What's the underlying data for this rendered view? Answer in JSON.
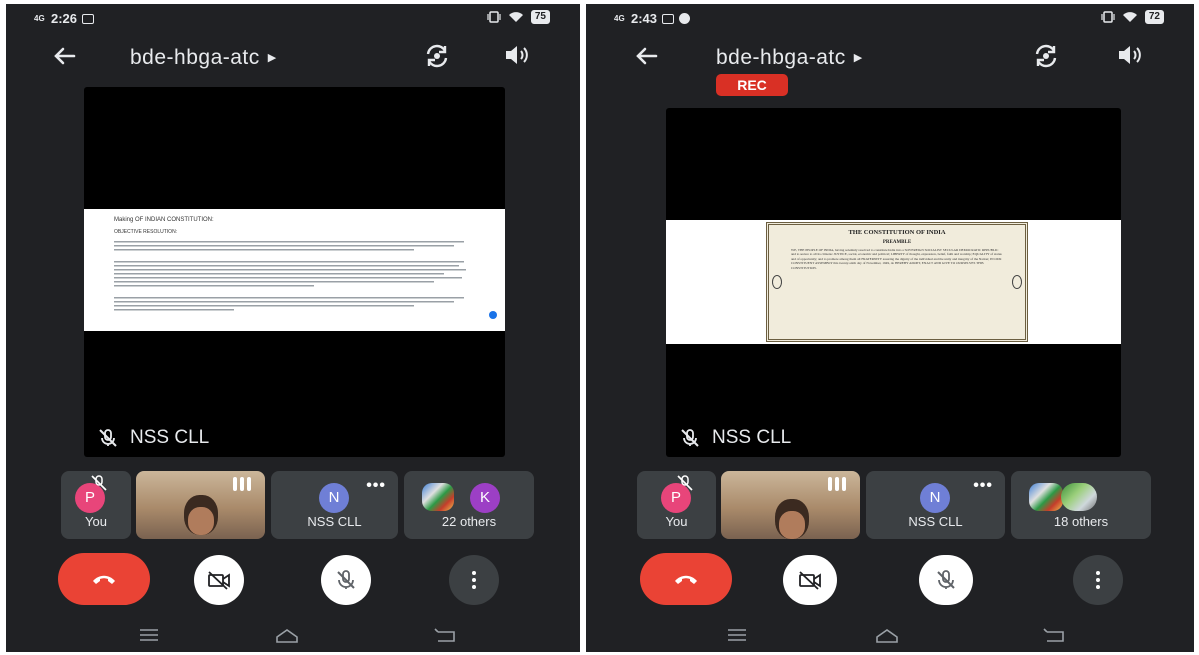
{
  "left": {
    "status": {
      "time": "2:26",
      "network": "4G",
      "battery": "75"
    },
    "meeting_title": "bde-hbga-atc",
    "presenter_name": "NSS CLL",
    "participants": [
      {
        "avatar_letter": "P",
        "label": "You",
        "avatar_color": "#e8457a"
      },
      {
        "label": ""
      },
      {
        "avatar_letter": "N",
        "label": "NSS CLL",
        "avatar_color": "#6f7fd6"
      },
      {
        "avatar_letter": "K",
        "label": "22 others",
        "avatar_color": "#9c3fc5"
      }
    ],
    "document": {
      "heading": "Making OF INDIAN CONSTITUTION:",
      "subheading": "OBJECTIVE RESOLUTION:"
    }
  },
  "right": {
    "status": {
      "time": "2:43",
      "network": "4G",
      "battery": "72"
    },
    "meeting_title": "bde-hbga-atc",
    "recording_label": "REC",
    "presenter_name": "NSS CLL",
    "participants": [
      {
        "avatar_letter": "P",
        "label": "You",
        "avatar_color": "#e8457a"
      },
      {
        "label": ""
      },
      {
        "avatar_letter": "N",
        "label": "NSS CLL",
        "avatar_color": "#6f7fd6"
      },
      {
        "label": "18 others"
      }
    ],
    "document": {
      "heading": "THE CONSTITUTION OF INDIA",
      "subheading": "PREAMBLE",
      "body": "WE, THE PEOPLE OF INDIA, having solemnly resolved to constitute India into a SOVEREIGN SOCIALIST SECULAR DEMOCRATIC REPUBLIC and to secure to all its citizens: JUSTICE, social, economic and political; LIBERTY of thought, expression, belief, faith and worship; EQUALITY of status and of opportunity; and to promote among them all FRATERNITY assuring the dignity of the individual and the unity and integrity of the Nation; IN OUR CONSTITUENT ASSEMBLY this twenty-sixth day of November, 1949, do HEREBY ADOPT, ENACT AND GIVE TO OURSELVES THIS CONSTITUTION."
    }
  },
  "colors": {
    "background": "#202124",
    "tile": "#3c4043",
    "end_call": "#ea4335",
    "rec": "#d93025"
  },
  "icons": [
    "back-arrow-icon",
    "caret-right-icon",
    "switch-camera-icon",
    "speaker-icon",
    "mic-off-icon",
    "more-vert-icon",
    "end-call-icon",
    "camera-off-icon",
    "recents-icon",
    "home-icon",
    "back-nav-icon",
    "bars-icon"
  ]
}
